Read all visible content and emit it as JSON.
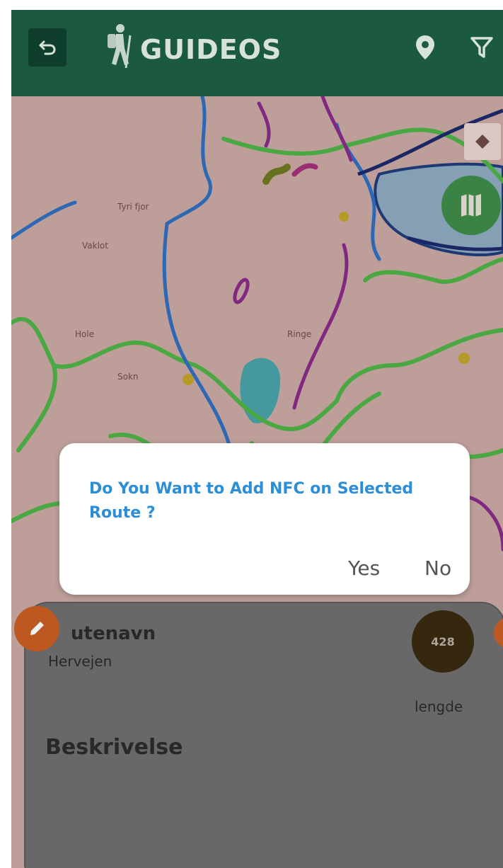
{
  "header": {
    "app_name": "GUIDEOS",
    "icons": [
      "back-icon",
      "hiker-logo-icon",
      "location-pin-icon",
      "filter-icon"
    ]
  },
  "map": {
    "controls": [
      "layers-icon",
      "map-icon"
    ],
    "place_labels": [
      "Tyri fjor",
      "Vaklot",
      "Hole",
      "Ringe",
      "Sokn"
    ]
  },
  "dialog": {
    "message": "Do You Want to Add NFC on Selected Route ?",
    "yes_label": "Yes",
    "no_label": "No"
  },
  "route_card": {
    "name_label": "utenavn",
    "name_value": "Hervejen",
    "length_value": "428",
    "length_label": "lengde",
    "description_label": "Beskrivelse"
  },
  "colors": {
    "header_bg": "#1b5a40",
    "dialog_text": "#2c8ed6",
    "accent_orange": "#c95e22",
    "map_toggle": "#3f8c4a"
  }
}
